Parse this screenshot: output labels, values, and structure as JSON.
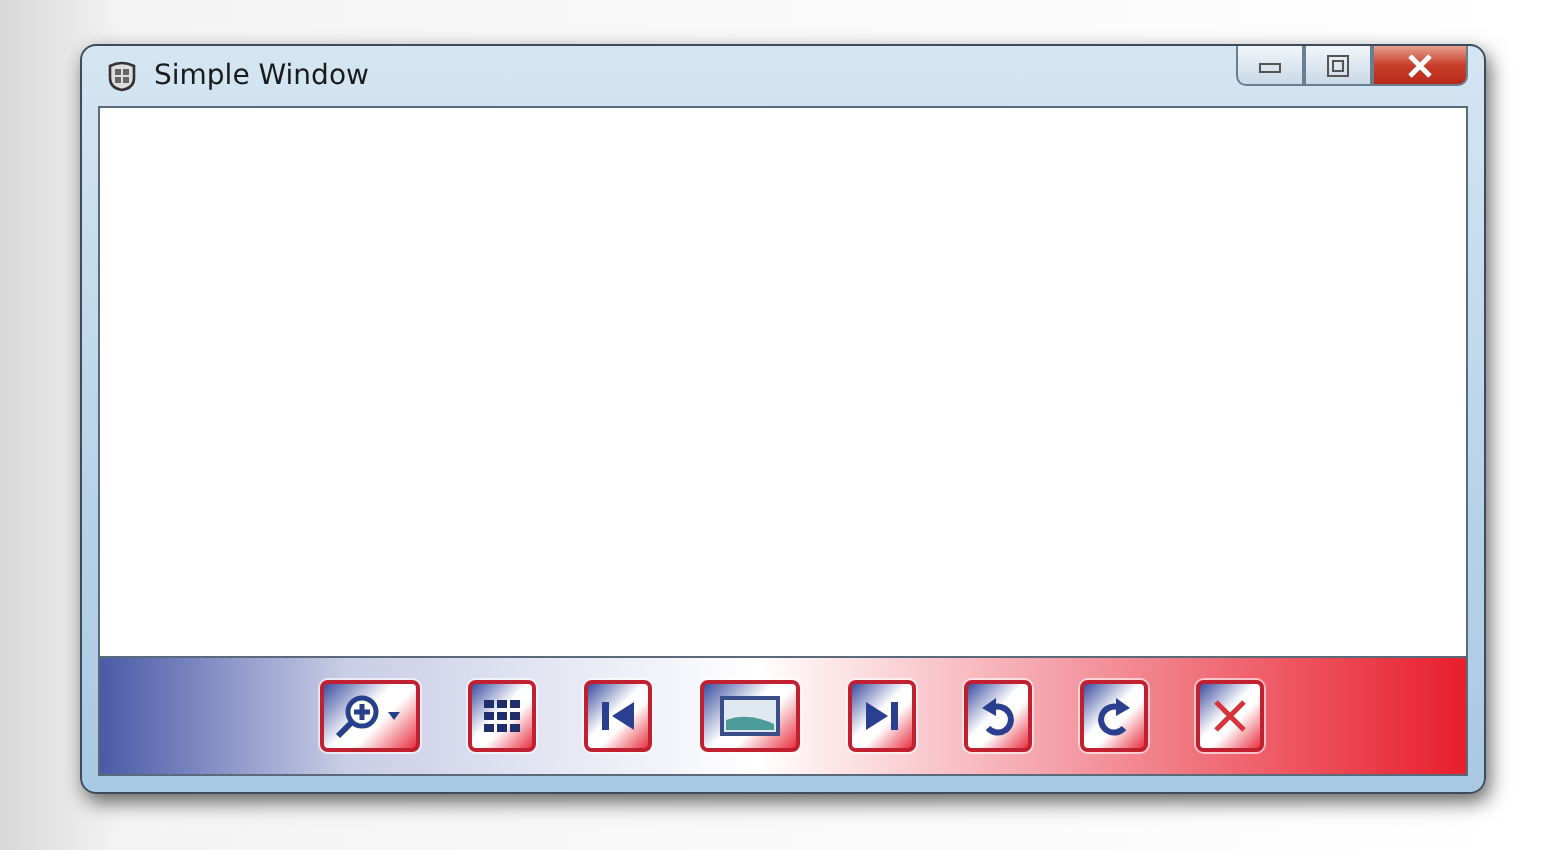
{
  "window": {
    "title": "Simple Window"
  },
  "toolbar": {
    "buttons": [
      {
        "kind": "zoom"
      },
      {
        "kind": "grid"
      },
      {
        "kind": "previous"
      },
      {
        "kind": "image"
      },
      {
        "kind": "next"
      },
      {
        "kind": "rotate-left"
      },
      {
        "kind": "rotate-right"
      },
      {
        "kind": "delete"
      }
    ]
  }
}
